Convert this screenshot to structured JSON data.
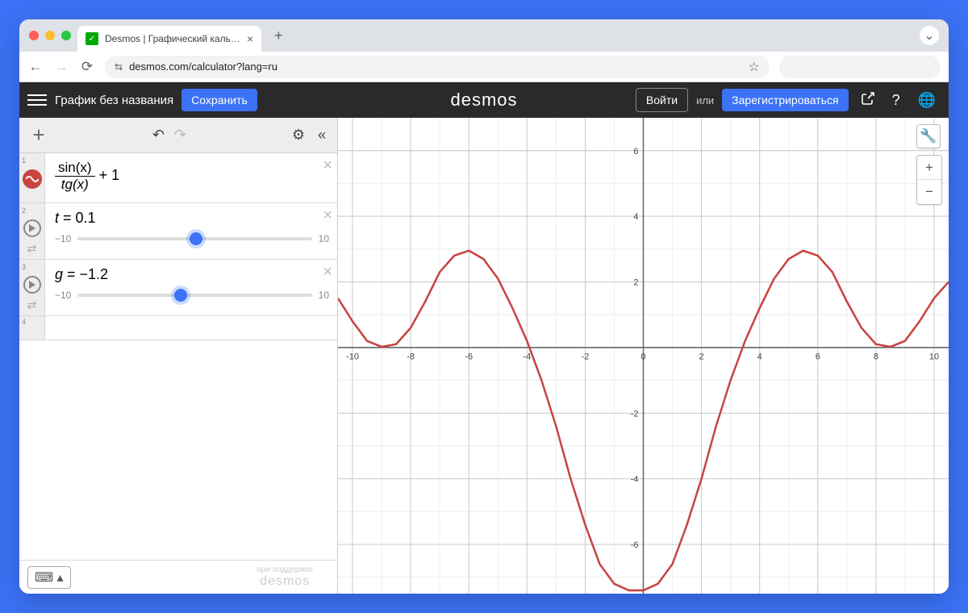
{
  "browser": {
    "tab_title": "Desmos | Графический каль…",
    "url": "desmos.com/calculator?lang=ru"
  },
  "header": {
    "title": "График без названия",
    "save": "Сохранить",
    "logo": "desmos",
    "login": "Войти",
    "or": "или",
    "register": "Зарегистрироваться"
  },
  "expressions": [
    {
      "index": "1",
      "type": "function",
      "frac_num": "sin(x)",
      "frac_den": "tg(x)",
      "plus": " + 1"
    },
    {
      "index": "2",
      "type": "slider",
      "var": "t",
      "eq": " = ",
      "value": "0.1",
      "min": "−10",
      "max": "10",
      "pos_pct": 50.5
    },
    {
      "index": "3",
      "type": "slider",
      "var": "g",
      "eq": " = ",
      "value": "−1.2",
      "min": "−10",
      "max": "10",
      "pos_pct": 44
    },
    {
      "index": "4",
      "type": "empty"
    }
  ],
  "footer": {
    "powered": "при поддержке",
    "brand": "desmos"
  },
  "chart_data": {
    "type": "line",
    "title": "",
    "xlabel": "",
    "ylabel": "",
    "xlim": [
      -10.5,
      10.5
    ],
    "ylim": [
      -7.5,
      7
    ],
    "xticks": [
      -10,
      -8,
      -6,
      -4,
      -2,
      0,
      2,
      4,
      6,
      8,
      10
    ],
    "yticks": [
      -6,
      -4,
      -2,
      2,
      4,
      6
    ],
    "series": [
      {
        "name": "sin(x)/tg(x)+1",
        "color": "#c74440",
        "x": [
          -10.5,
          -10,
          -9.5,
          -9,
          -8.5,
          -8,
          -7.5,
          -7,
          -6.5,
          -6,
          -5.5,
          -5,
          -4.5,
          -4,
          -3.5,
          -3,
          -2.5,
          -2,
          -1.5,
          -1,
          -0.5,
          0,
          0.5,
          1,
          1.5,
          2,
          2.5,
          3,
          3.5,
          4,
          4.5,
          5,
          5.5,
          6,
          6.5,
          7,
          7.5,
          8,
          8.5,
          9,
          9.5,
          10,
          10.5
        ],
        "y": [
          1.5,
          0.8,
          0.2,
          0.02,
          0.1,
          0.6,
          1.4,
          2.3,
          2.8,
          2.95,
          2.7,
          2.1,
          1.2,
          0.2,
          -1.0,
          -2.4,
          -4.0,
          -5.4,
          -6.6,
          -7.2,
          -7.4,
          -7.4,
          -7.2,
          -6.6,
          -5.4,
          -4.0,
          -2.4,
          -1.0,
          0.2,
          1.2,
          2.1,
          2.7,
          2.95,
          2.8,
          2.3,
          1.4,
          0.6,
          0.1,
          0.02,
          0.2,
          0.8,
          1.5,
          2.0
        ]
      }
    ]
  }
}
